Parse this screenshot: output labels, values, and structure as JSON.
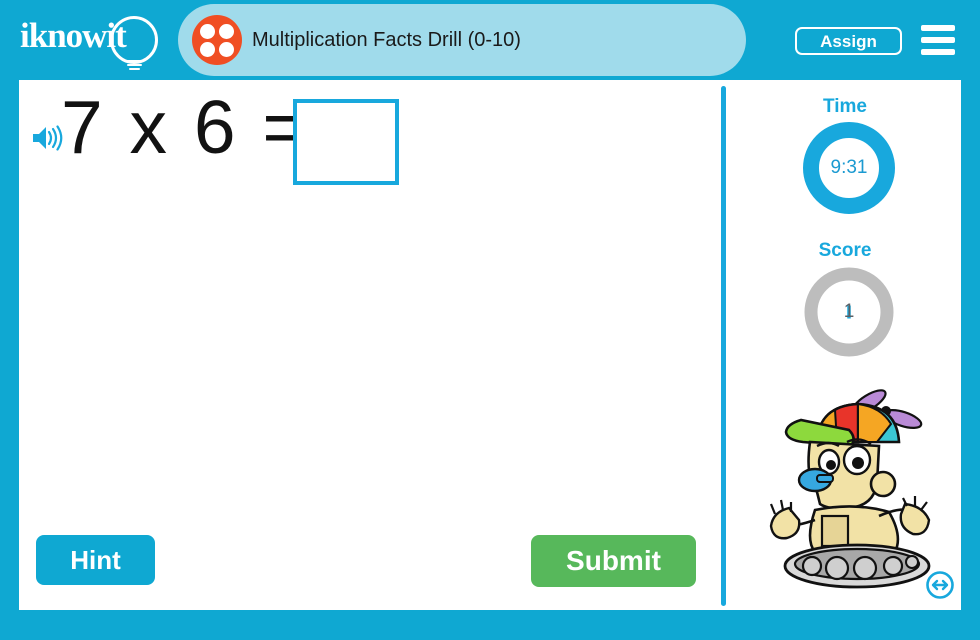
{
  "app": {
    "logo_text": "iknowit",
    "frame_color": "#0fa8d2",
    "accent_color": "#18a8dd"
  },
  "header": {
    "title": "Multiplication Facts Drill (0-10)",
    "tab_color": "#a0dbeb",
    "dots_color": "#f04e23",
    "assign_label": "Assign",
    "menu_icon": "hamburger-menu-icon"
  },
  "problem": {
    "speaker_icon": "speaker-audio-icon",
    "expression": "7 x 6 =",
    "answer_value": "",
    "answer_placeholder": ""
  },
  "sidebar": {
    "time": {
      "label": "Time",
      "value": "9:31",
      "ring_color": "#18a8dd"
    },
    "score": {
      "label": "Score",
      "value": "1",
      "ring_color": "#bdbdbd",
      "tick_color": "#18a8dd"
    },
    "mascot_icon": "robot-mascot-propeller-hat",
    "resize_icon": "horizontal-resize-arrow-icon"
  },
  "actions": {
    "hint_label": "Hint",
    "hint_color": "#0fa8d2",
    "submit_label": "Submit",
    "submit_color": "#57b85b"
  }
}
